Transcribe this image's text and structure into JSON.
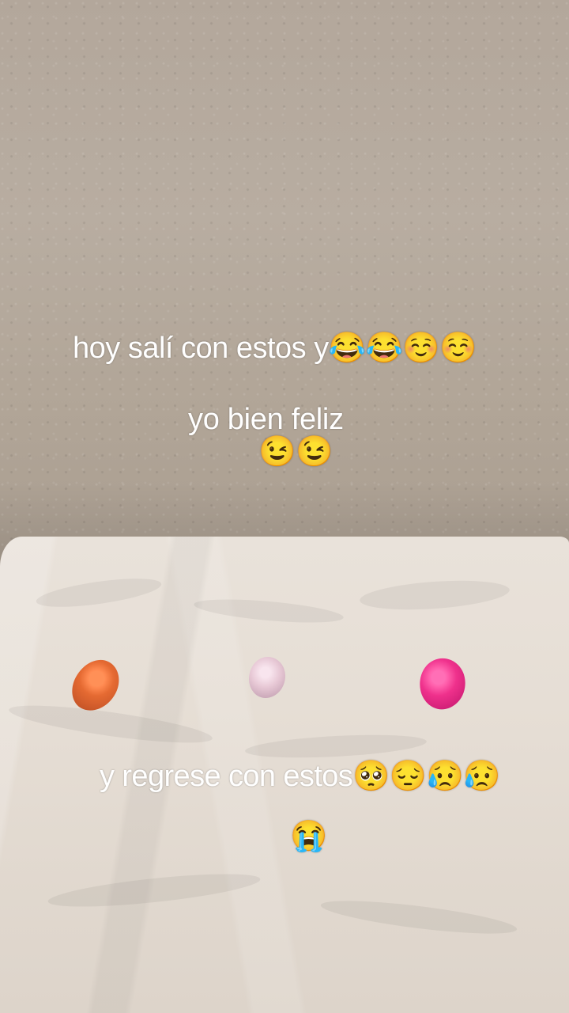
{
  "captions": {
    "line_1": "hoy salí con estos y😂😂☺️☺️",
    "line_2": "yo bien feliz",
    "line_3": "😉😉",
    "line_4": "y regrese con estos🥺😔😥😥",
    "line_5": "😭"
  },
  "objects": {
    "pompoms": [
      "orange",
      "light-pink",
      "hot-pink"
    ],
    "colors": {
      "orange": "#e06b36",
      "light_pink": "#e6c8d5",
      "hot_pink": "#e8338a"
    }
  }
}
